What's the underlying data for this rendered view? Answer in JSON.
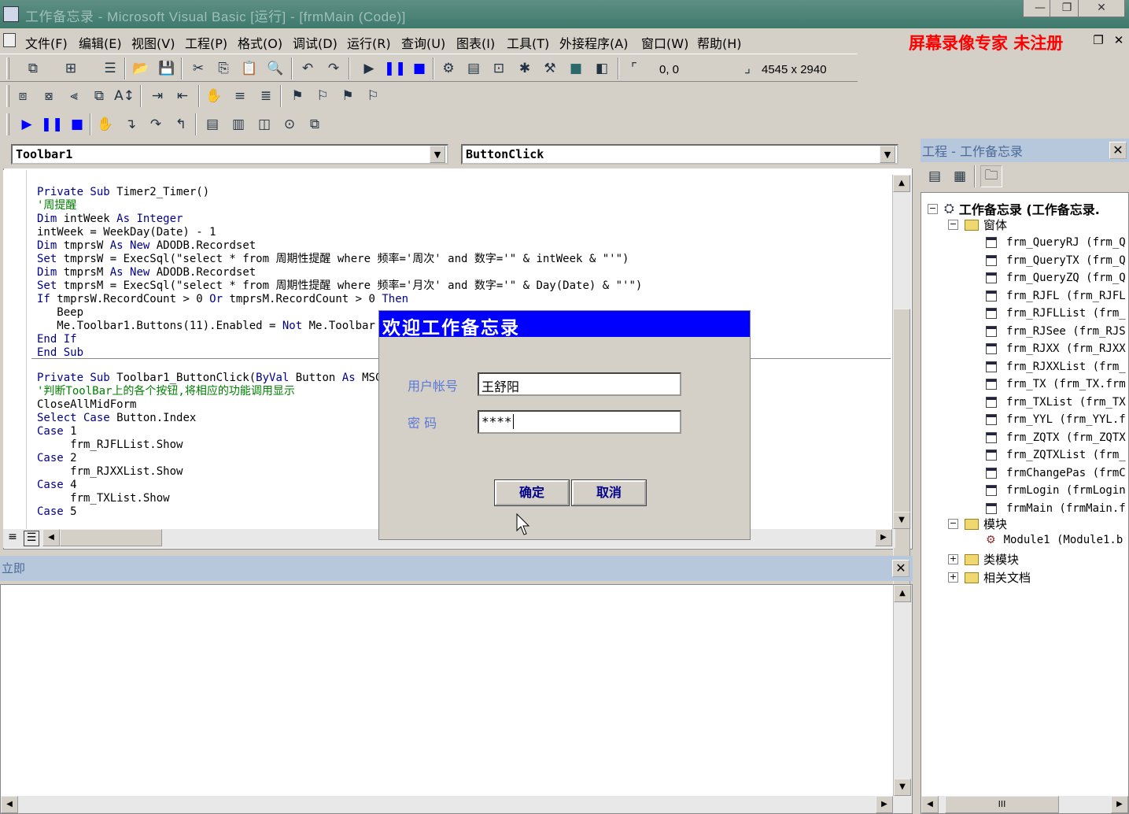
{
  "window": {
    "title": "工作备忘录 - Microsoft Visual Basic [运行] - [frmMain (Code)]",
    "controls": [
      "—",
      "❐",
      "✕"
    ]
  },
  "menu": {
    "items": [
      "文件(F)",
      "编辑(E)",
      "视图(V)",
      "工程(P)",
      "格式(O)",
      "调试(D)",
      "运行(R)",
      "查询(U)",
      "图表(I)",
      "工具(T)",
      "外接程序(A)",
      "窗口(W)",
      "帮助(H)"
    ],
    "recorder_banner": "屏幕录像专家  未注册",
    "mdi_controls": [
      "❐",
      "✕"
    ]
  },
  "toolbar": {
    "position": "0, 0",
    "size": "4545 x 2940"
  },
  "code_window": {
    "object_combo": "Toolbar1",
    "procedure_combo": "ButtonClick",
    "lines_top": [
      [
        [
          "kw",
          "Private Sub "
        ],
        [
          "",
          "Timer2_Timer()"
        ]
      ],
      [
        [
          "cm",
          "'周提醒"
        ]
      ],
      [
        [
          "kw",
          "Dim "
        ],
        [
          "",
          "intWeek "
        ],
        [
          "kw",
          "As Integer"
        ]
      ],
      [
        [
          "",
          "intWeek = WeekDay(Date) - 1"
        ]
      ],
      [
        [
          "kw",
          "Dim "
        ],
        [
          "",
          "tmprsW "
        ],
        [
          "kw",
          "As New "
        ],
        [
          "",
          "ADODB.Recordset"
        ]
      ],
      [
        [
          "kw",
          "Set "
        ],
        [
          "",
          "tmprsW = ExecSql(\"select * from 周期性提醒 where 频率='周次' and 数字='\" & intWeek & \"'\")"
        ]
      ],
      [
        [
          "kw",
          "Dim "
        ],
        [
          "",
          "tmprsM "
        ],
        [
          "kw",
          "As New "
        ],
        [
          "",
          "ADODB.Recordset"
        ]
      ],
      [
        [
          "kw",
          "Set "
        ],
        [
          "",
          "tmprsM = ExecSql(\"select * from 周期性提醒 where 频率='月次' and 数字='\" & Day(Date) & \"'\")"
        ]
      ],
      [
        [
          "kw",
          "If "
        ],
        [
          "",
          "tmprsW.RecordCount > 0 "
        ],
        [
          "kw",
          "Or "
        ],
        [
          "",
          "tmprsM.RecordCount > 0 "
        ],
        [
          "kw",
          "Then"
        ]
      ],
      [
        [
          "",
          "   Beep"
        ]
      ],
      [
        [
          "",
          "   Me.Toolbar1.Buttons(11).Enabled = "
        ],
        [
          "kw",
          "Not "
        ],
        [
          "",
          "Me.Toolbar"
        ]
      ],
      [
        [
          "kw",
          "End If"
        ]
      ],
      [
        [
          "kw",
          "End Sub"
        ]
      ]
    ],
    "lines_bottom": [
      [
        [
          "kw",
          "Private Sub "
        ],
        [
          "",
          "Toolbar1_ButtonClick("
        ],
        [
          "kw",
          "ByVal "
        ],
        [
          "",
          "Button "
        ],
        [
          "kw",
          "As "
        ],
        [
          "",
          "MSC"
        ]
      ],
      [
        [
          "cm",
          "'判断ToolBar上的各个按钮,将相应的功能调用显示"
        ]
      ],
      [
        [
          "",
          "CloseAllMidForm"
        ]
      ],
      [
        [
          "kw",
          "Select Case "
        ],
        [
          "",
          "Button.Index"
        ]
      ],
      [
        [
          "kw",
          "Case "
        ],
        [
          "",
          "1"
        ]
      ],
      [
        [
          "",
          "     frm_RJFLList.Show"
        ]
      ],
      [
        [
          "kw",
          "Case "
        ],
        [
          "",
          "2"
        ]
      ],
      [
        [
          "",
          "     frm_RJXXList.Show"
        ]
      ],
      [
        [
          "kw",
          "Case "
        ],
        [
          "",
          "4"
        ]
      ],
      [
        [
          "",
          "     frm_TXList.Show"
        ]
      ],
      [
        [
          "kw",
          "Case "
        ],
        [
          "",
          "5"
        ]
      ]
    ]
  },
  "login_dialog": {
    "title": "欢迎工作备忘录",
    "user_label": "用户帐号",
    "user_value": "王舒阳",
    "password_label": "密    码",
    "password_value": "****",
    "ok_label": "确定",
    "cancel_label": "取消"
  },
  "immediate": {
    "title": "立即",
    "close": "✕"
  },
  "project": {
    "title": "工程 - 工作备忘录",
    "close": "✕",
    "root": "工作备忘录 (工作备忘录.",
    "forms_folder": "窗体",
    "forms": [
      "frm_QueryRJ (frm_Q",
      "frm_QueryTX (frm_Q",
      "frm_QueryZQ (frm_Q",
      "frm_RJFL (frm_RJFL",
      "frm_RJFLList (frm_",
      "frm_RJSee (frm_RJS",
      "frm_RJXX (frm_RJXX",
      "frm_RJXXList (frm_",
      "frm_TX (frm_TX.frm",
      "frm_TXList (frm_TX",
      "frm_YYL (frm_YYL.f",
      "frm_ZQTX (frm_ZQTX",
      "frm_ZQTXList (frm_",
      "frmChangePas (frmC",
      "frmLogin (frmLogin",
      "frmMain (frmMain.f"
    ],
    "modules_folder": "模块",
    "modules": [
      "Module1 (Module1.b"
    ],
    "class_folder": "类模块",
    "docs_folder": "相关文档",
    "hscroll_thumb": "III"
  },
  "colors": {
    "title_bar": "#3e7a6c",
    "dialog_title": "#0000ff",
    "keyword": "#00008b",
    "comment": "#008000",
    "banner": "#ff0000"
  }
}
